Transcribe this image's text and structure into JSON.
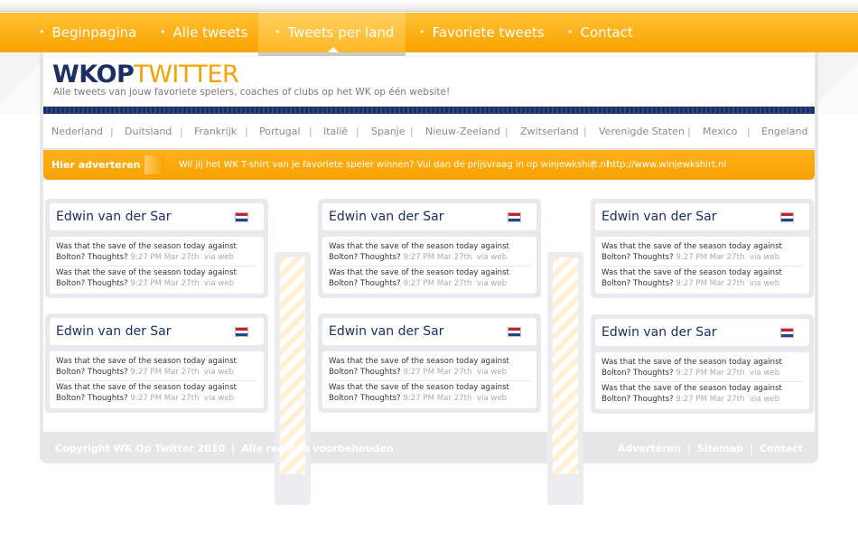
{
  "nav": {
    "items": [
      {
        "label": "Beginpagina",
        "active": false
      },
      {
        "label": "Alle tweets",
        "active": false
      },
      {
        "label": "Tweets per land",
        "active": true
      },
      {
        "label": "Favoriete tweets",
        "active": false
      },
      {
        "label": "Contact",
        "active": false
      }
    ],
    "bullet": "•"
  },
  "header": {
    "logo_part1": "WKOP",
    "logo_part2": "TWITTER",
    "tagline": "Alle tweets van jouw favoriete spelers, coaches of clubs op het WK op één website!"
  },
  "countries": [
    "Nederland",
    "Duitsland",
    "Frankrijk",
    "Portugal",
    "Italië",
    "Spanje",
    "Nieuw-Zeeland",
    "Zwitserland",
    "Verenigde Staten",
    "Mexico",
    "Engeland"
  ],
  "country_separator": "|",
  "adbar": {
    "label": "Hier adverteren",
    "text": "Wil jij het WK T-shirt van je favoriete speler winnen? Vul dan de prijsvraag in op winjewkshirt.nl",
    "separator": "|",
    "url": "http://www.winjewkshirt.nl"
  },
  "cards": [
    {
      "name": "Edwin van der Sar",
      "flag": "netherlands-flag-icon",
      "tweets": [
        {
          "text": "Was that the save of the season today against Bolton? Thoughts?",
          "time": "9:27 PM Mar 27th",
          "via": "via web"
        },
        {
          "text": "Was that the save of the season today against Bolton? Thoughts?",
          "time": "9:27 PM Mar 27th",
          "via": "via web"
        }
      ]
    },
    {
      "name": "Edwin van der Sar",
      "flag": "netherlands-flag-icon",
      "tweets": [
        {
          "text": "Was that the save of the season today against Bolton? Thoughts?",
          "time": "9:27 PM Mar 27th",
          "via": "via web"
        },
        {
          "text": "Was that the save of the season today against Bolton? Thoughts?",
          "time": "9:27 PM Mar 27th",
          "via": "via web"
        }
      ]
    },
    {
      "name": "Edwin van der Sar",
      "flag": "netherlands-flag-icon",
      "tweets": [
        {
          "text": "Was that the save of the season today against Bolton? Thoughts?",
          "time": "9:27 PM Mar 27th",
          "via": "via web"
        },
        {
          "text": "Was that the save of the season today against Bolton? Thoughts?",
          "time": "9:27 PM Mar 27th",
          "via": "via web"
        }
      ]
    },
    {
      "name": "Edwin van der Sar",
      "flag": "netherlands-flag-icon",
      "tweets": [
        {
          "text": "Was that the save of the season today against Bolton? Thoughts?",
          "time": "9:27 PM Mar 27th",
          "via": "via web"
        },
        {
          "text": "Was that the save of the season today against Bolton? Thoughts?",
          "time": "9:27 PM Mar 27th",
          "via": "via web"
        }
      ]
    },
    {
      "name": "Edwin van der Sar",
      "flag": "netherlands-flag-icon",
      "tweets": [
        {
          "text": "Was that the save of the season today against Bolton? Thoughts?",
          "time": "9:27 PM Mar 27th",
          "via": "via web"
        },
        {
          "text": "Was that the save of the season today against Bolton? Thoughts?",
          "time": "9:27 PM Mar 27th",
          "via": "via web"
        }
      ]
    },
    {
      "name": "Edwin van der Sar",
      "flag": "netherlands-flag-icon",
      "tweets": [
        {
          "text": "Was that the save of the season today against Bolton? Thoughts?",
          "time": "9:27 PM Mar 27th",
          "via": "via web"
        },
        {
          "text": "Was that the save of the season today against Bolton? Thoughts?",
          "time": "9:27 PM Mar 27th",
          "via": "via web"
        }
      ]
    }
  ],
  "footer": {
    "copyright": "Copyright WK Op Twitter 2010",
    "rights": "Alle rechten voorbehouden",
    "separator": "|",
    "links": [
      "Adverteren",
      "Sitemap",
      "Contact"
    ]
  },
  "colors": {
    "orange": "#f7a100",
    "navy": "#1b2f63",
    "panel": "#e8e8ef"
  }
}
